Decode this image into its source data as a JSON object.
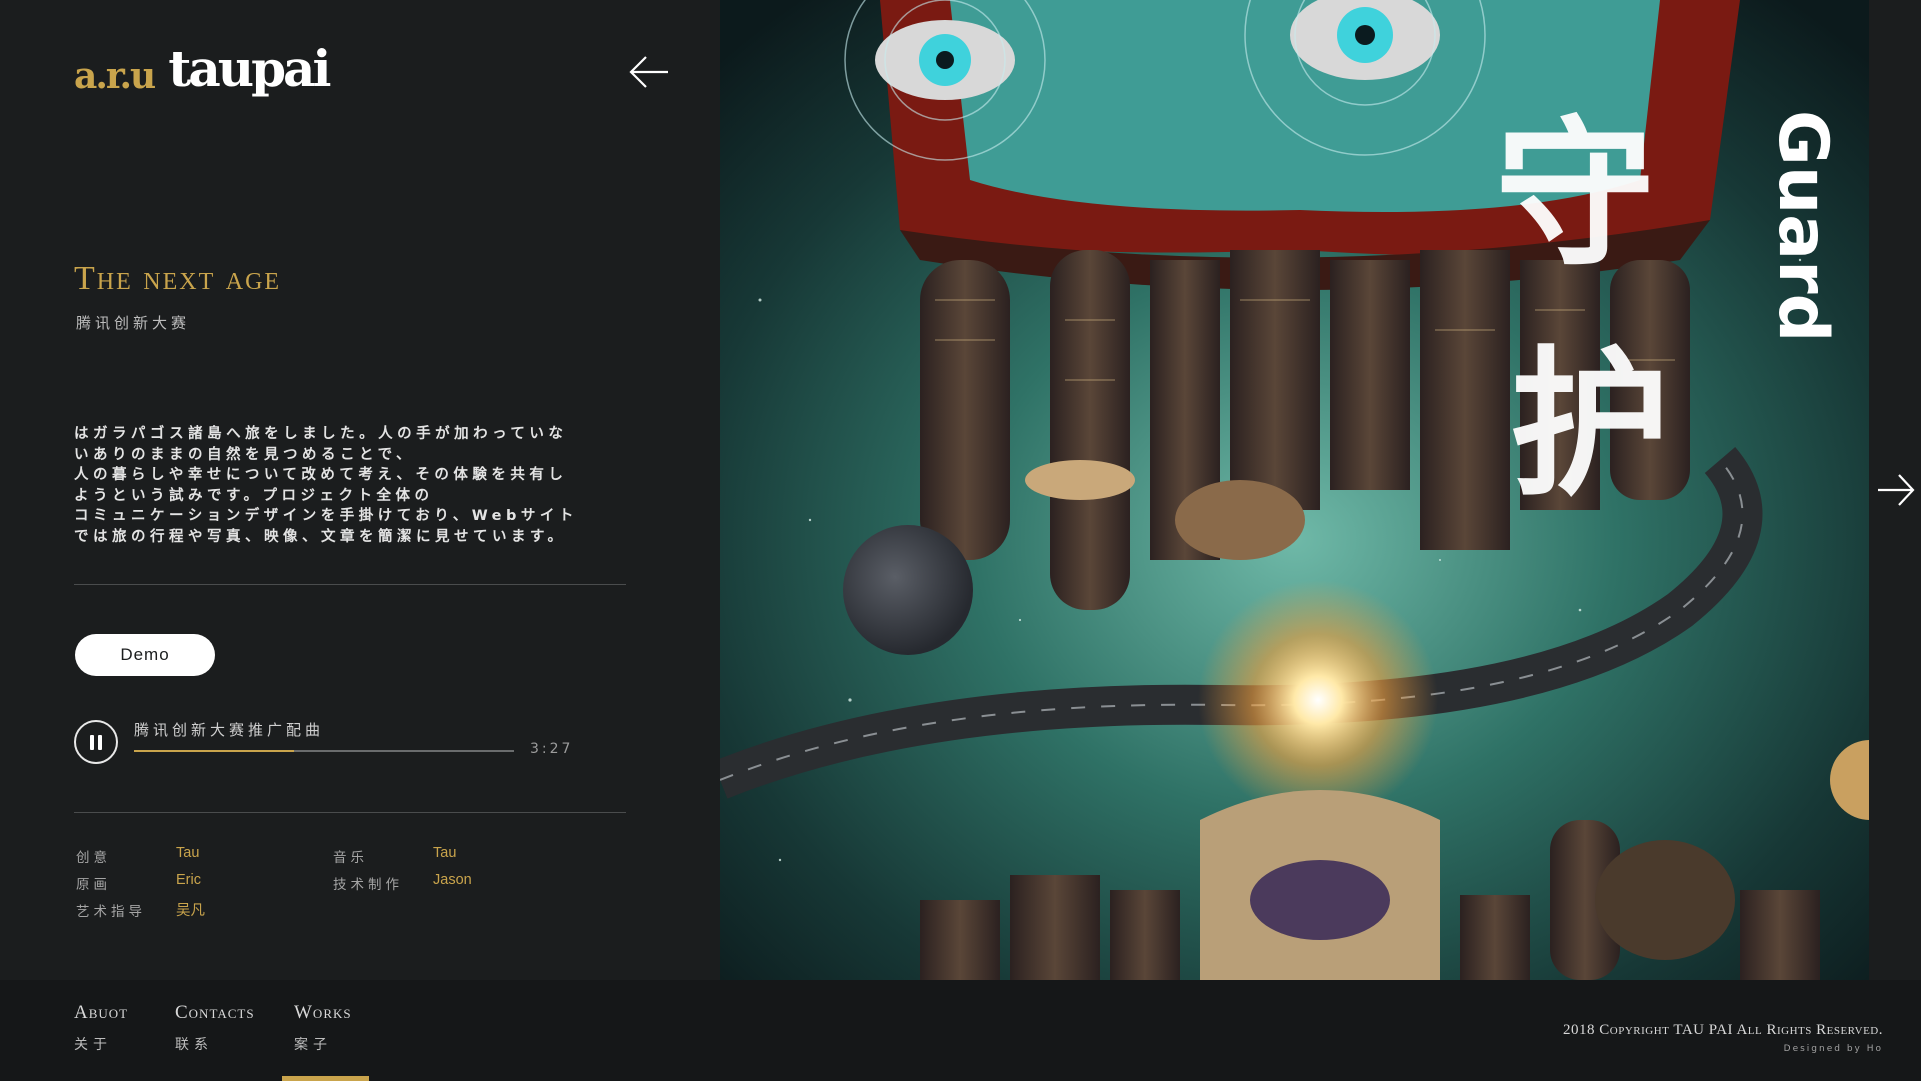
{
  "brand": {
    "logo_glyph": "a.r.u",
    "logo_text": "taupai"
  },
  "project": {
    "title": "The next age",
    "subtitle": "腾讯创新大赛",
    "description_lines": [
      "はガラパゴス諸島へ旅をしました。人の手が加わっていな",
      "いありのままの自然を見つめることで、",
      "人の暮らしや幸せについて改めて考え、その体験を共有し",
      "ようという試みです。プロジェクト全体の",
      "コミュニケーションデザインを手掛けており、Webサイト",
      "では旅の行程や写真、映像、文章を簡潔に見せています。"
    ],
    "demo_label": "Demo"
  },
  "player": {
    "track_title": "腾讯创新大赛推广配曲",
    "duration": "3:27",
    "progress": 0.42
  },
  "credits": [
    {
      "role": "创意",
      "name": "Tau"
    },
    {
      "role": "原画",
      "name": "Eric"
    },
    {
      "role": "艺术指导",
      "name": "吴凡"
    },
    {
      "role": "音乐",
      "name": "Tau"
    },
    {
      "role": "技术制作",
      "name": "Jason"
    }
  ],
  "artwork": {
    "title_cn": "守护",
    "title_en": "Guard"
  },
  "footer": {
    "nav": [
      {
        "en": "Abuot",
        "cn": "关于"
      },
      {
        "en": "Contacts",
        "cn": "联系"
      },
      {
        "en": "Works",
        "cn": "案子"
      }
    ],
    "active_nav": "Works",
    "copyright": "2018 Copyright TAU PAI All Rights Reserved.",
    "designed_by": "Designed by Ho"
  },
  "colors": {
    "accent": "#c9a44c",
    "background": "#1b1d1e",
    "footer": "#151718"
  },
  "icons": {
    "back": "arrow-left-icon",
    "next": "arrow-right-icon",
    "pause": "pause-icon"
  }
}
